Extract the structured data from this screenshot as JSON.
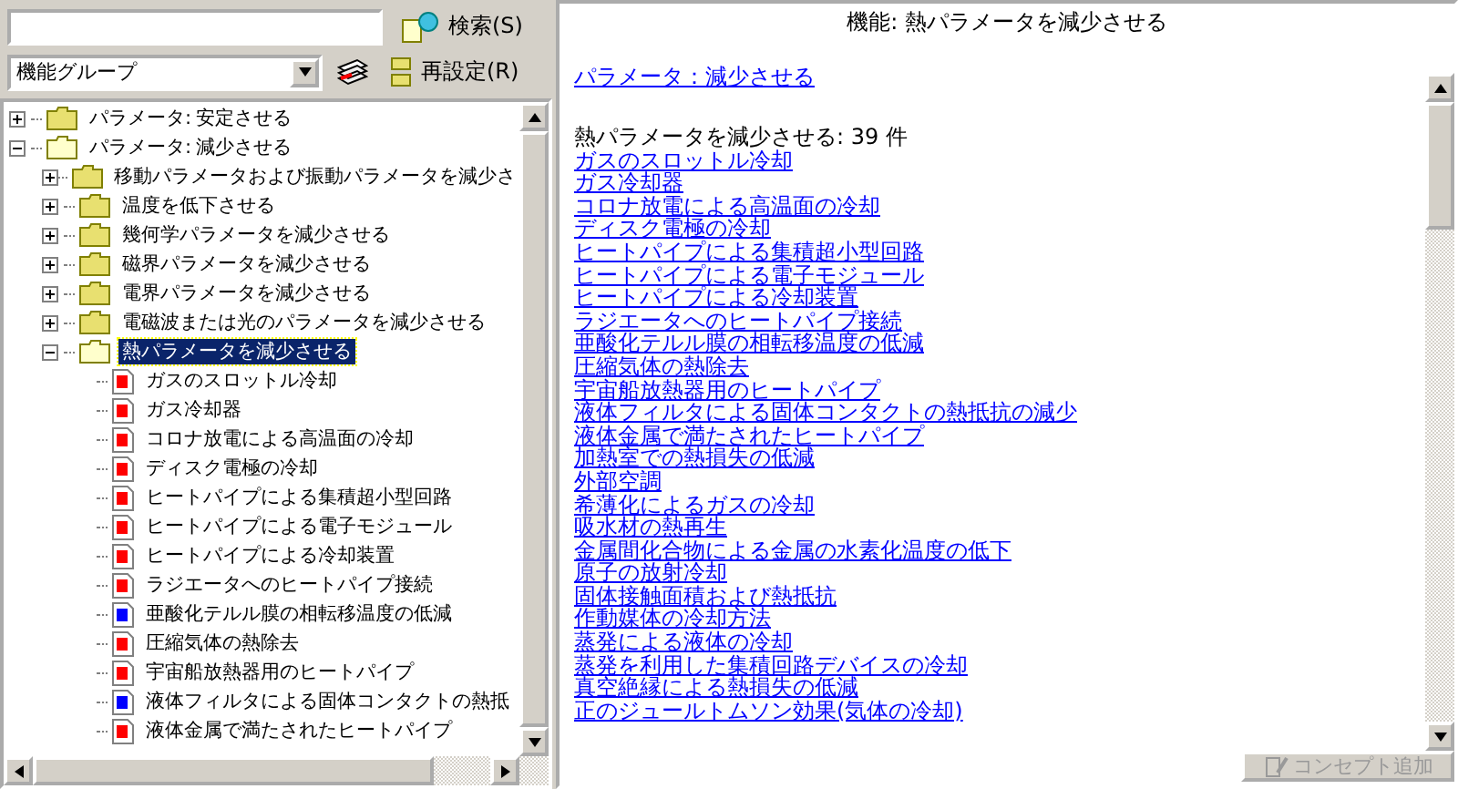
{
  "search": {
    "button": "検索(S)"
  },
  "group_select": {
    "value": "機能グループ",
    "reset_button": "再設定(R)"
  },
  "tree": [
    {
      "label": "パラメータ: 安定させる",
      "kind": "folder",
      "expanded": false,
      "selected": false
    },
    {
      "label": "パラメータ: 減少させる",
      "kind": "folder",
      "expanded": true,
      "selected": false,
      "children": [
        {
          "label": "移動パラメータおよび振動パラメータを減少さ",
          "kind": "folder",
          "expanded": false,
          "selected": false
        },
        {
          "label": "温度を低下させる",
          "kind": "folder",
          "expanded": false,
          "selected": false
        },
        {
          "label": "幾何学パラメータを減少させる",
          "kind": "folder",
          "expanded": false,
          "selected": false
        },
        {
          "label": "磁界パラメータを減少させる",
          "kind": "folder",
          "expanded": false,
          "selected": false
        },
        {
          "label": "電界パラメータを減少させる",
          "kind": "folder",
          "expanded": false,
          "selected": false
        },
        {
          "label": "電磁波または光のパラメータを減少させる",
          "kind": "folder",
          "expanded": false,
          "selected": false
        },
        {
          "label": "熱パラメータを減少させる",
          "kind": "folder",
          "expanded": true,
          "selected": true,
          "children": [
            {
              "label": "ガスのスロットル冷却",
              "kind": "leaf",
              "color": "#ff0000",
              "selected": false
            },
            {
              "label": "ガス冷却器",
              "kind": "leaf",
              "color": "#ff0000",
              "selected": false
            },
            {
              "label": "コロナ放電による高温面の冷却",
              "kind": "leaf",
              "color": "#ff0000",
              "selected": false
            },
            {
              "label": "ディスク電極の冷却",
              "kind": "leaf",
              "color": "#ff0000",
              "selected": false
            },
            {
              "label": "ヒートパイプによる集積超小型回路",
              "kind": "leaf",
              "color": "#ff0000",
              "selected": false
            },
            {
              "label": "ヒートパイプによる電子モジュール",
              "kind": "leaf",
              "color": "#ff0000",
              "selected": false
            },
            {
              "label": "ヒートパイプによる冷却装置",
              "kind": "leaf",
              "color": "#ff0000",
              "selected": false
            },
            {
              "label": "ラジエータへのヒートパイプ接続",
              "kind": "leaf",
              "color": "#ff0000",
              "selected": false
            },
            {
              "label": "亜酸化テルル膜の相転移温度の低減",
              "kind": "leaf",
              "color": "#0000ff",
              "selected": false
            },
            {
              "label": "圧縮気体の熱除去",
              "kind": "leaf",
              "color": "#ff0000",
              "selected": false
            },
            {
              "label": "宇宙船放熱器用のヒートパイプ",
              "kind": "leaf",
              "color": "#ff0000",
              "selected": false
            },
            {
              "label": "液体フィルタによる固体コンタクトの熱抵",
              "kind": "leaf",
              "color": "#0000ff",
              "selected": false
            },
            {
              "label": "液体金属で満たされたヒートパイプ",
              "kind": "leaf",
              "color": "#ff0000",
              "selected": false
            }
          ]
        }
      ]
    }
  ],
  "detail": {
    "title": "機能: 熱パラメータを減少させる",
    "parent_link": "パラメータ：減少させる",
    "count_heading": "熱パラメータを減少させる: 39 件",
    "links": [
      "ガスのスロットル冷却",
      "ガス冷却器",
      "コロナ放電による高温面の冷却",
      "ディスク電極の冷却",
      "ヒートパイプによる集積超小型回路",
      "ヒートパイプによる電子モジュール",
      "ヒートパイプによる冷却装置",
      "ラジエータへのヒートパイプ接続",
      "亜酸化テルル膜の相転移温度の低減",
      "圧縮気体の熱除去",
      "宇宙船放熱器用のヒートパイプ",
      "液体フィルタによる固体コンタクトの熱抵抗の減少",
      "液体金属で満たされたヒートパイプ",
      "加熱室での熱損失の低減",
      "外部空調",
      "希薄化によるガスの冷却",
      "吸水材の熱再生",
      "金属間化合物による金属の水素化温度の低下",
      "原子の放射冷却",
      "固体接触面積および熱抵抗",
      "作動媒体の冷却方法",
      "蒸発による液体の冷却",
      "蒸発を利用した集積回路デバイスの冷却",
      "真空絶縁による熱損失の低減",
      "正のジュールトムソン効果(気体の冷却)"
    ],
    "add_button": {
      "label": "コンセプト追加",
      "disabled": true
    }
  }
}
